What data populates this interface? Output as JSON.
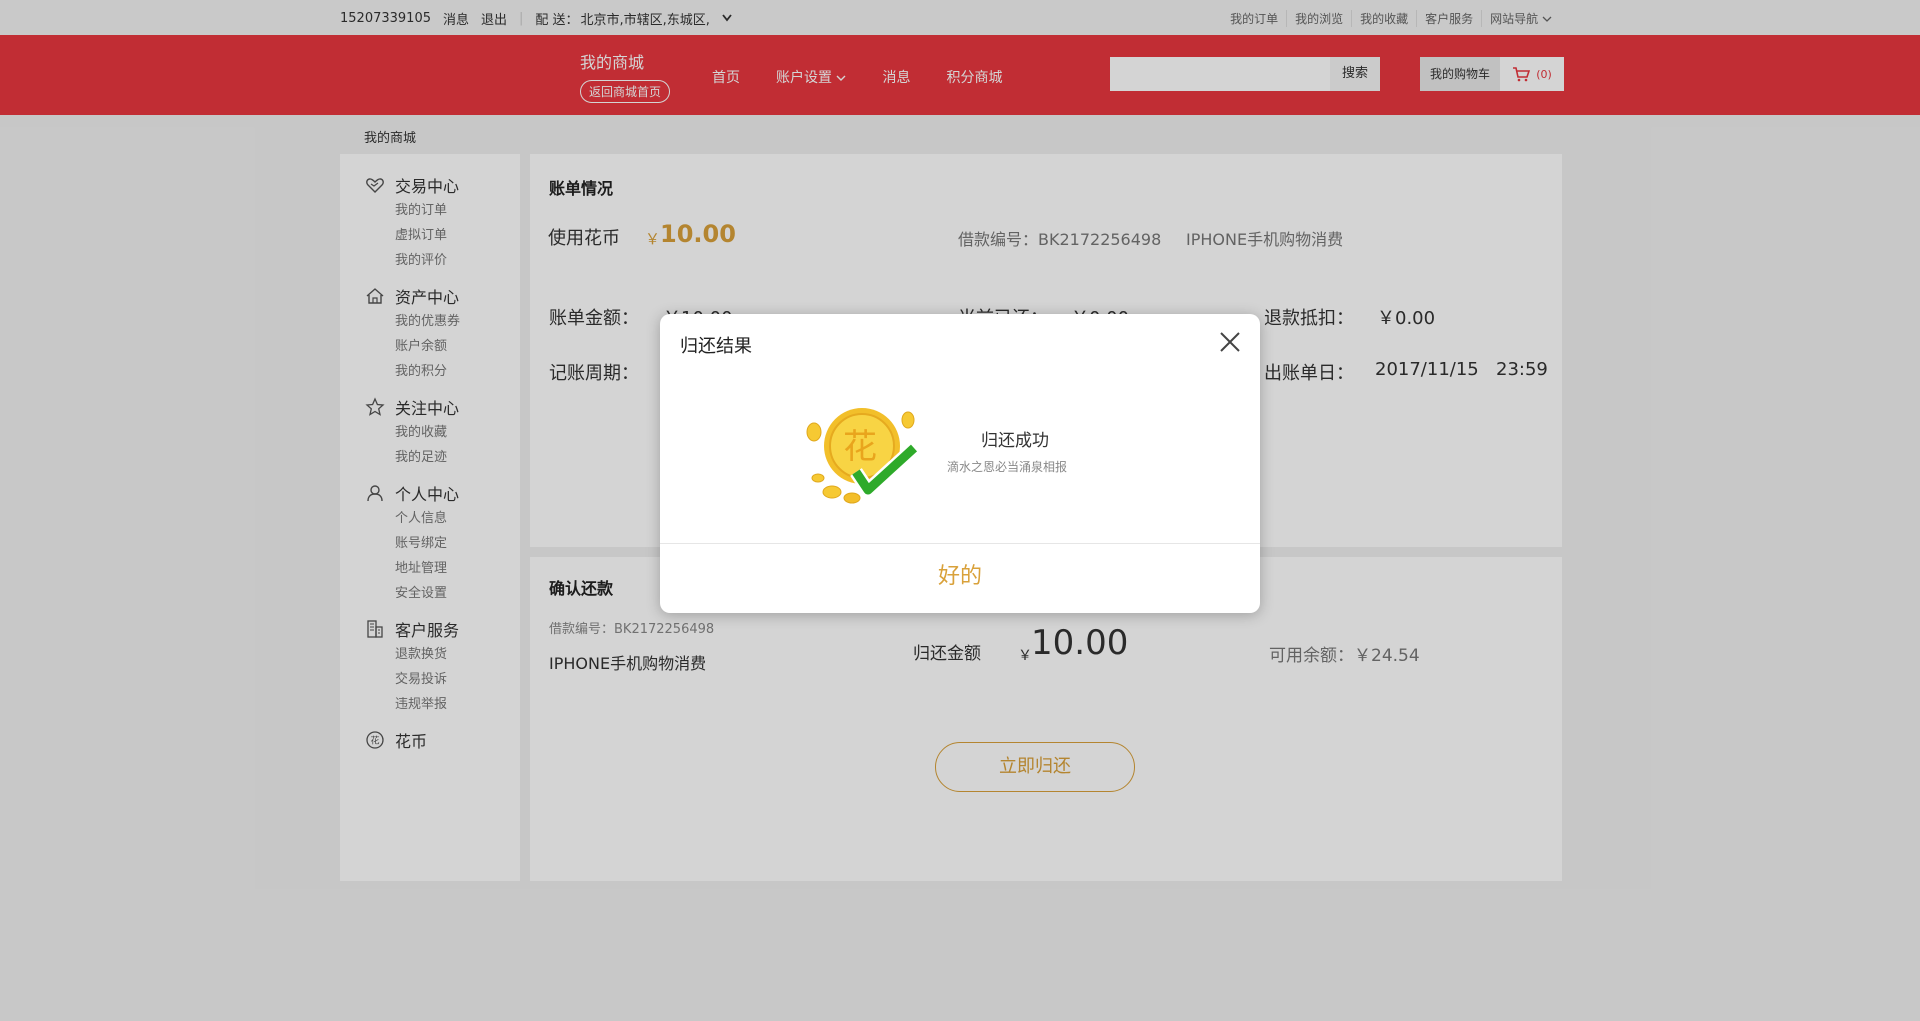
{
  "topbar": {
    "phone": "15207339105",
    "message": "消息",
    "logout": "退出",
    "delivery_label": "配  送：",
    "delivery_location": "北京市,市辖区,东城区,",
    "links": [
      "我的订单",
      "我的浏览",
      "我的收藏",
      "客户服务",
      "网站导航"
    ]
  },
  "header": {
    "brand": "我的商城",
    "back_home": "返回商城首页",
    "nav": [
      "首页",
      "账户设置",
      "消息",
      "积分商城"
    ],
    "search_button": "搜索",
    "search_placeholder": "",
    "cart_label": "我的购物车",
    "cart_count": "(0)"
  },
  "breadcrumb": "我的商城",
  "sidebar": {
    "groups": [
      {
        "title": "交易中心",
        "icon": "handshake-icon",
        "items": [
          "我的订单",
          "虚拟订单",
          "我的评价"
        ]
      },
      {
        "title": "资产中心",
        "icon": "home-icon",
        "items": [
          "我的优惠券",
          "账户余额",
          "我的积分"
        ]
      },
      {
        "title": "关注中心",
        "icon": "star-icon",
        "items": [
          "我的收藏",
          "我的足迹"
        ]
      },
      {
        "title": "个人中心",
        "icon": "user-icon",
        "items": [
          "个人信息",
          "账号绑定",
          "地址管理",
          "安全设置"
        ]
      },
      {
        "title": "客户服务",
        "icon": "building-icon",
        "items": [
          "退款换货",
          "交易投诉",
          "违规举报"
        ]
      },
      {
        "title": "花币",
        "icon": "coin-icon",
        "items": []
      }
    ]
  },
  "bill": {
    "title": "账单情况",
    "use_label": "使用花币",
    "currency": "￥",
    "use_amount": "10.00",
    "loan_no": "借款编号：BK2172256498",
    "desc": "IPHONE手机购物消费",
    "amount_label": "账单金额：",
    "amount_value": "￥10.00",
    "repaid_label": "当前已还：",
    "repaid_value": "￥0.00",
    "refund_label": "退款抵扣：",
    "refund_value": "￥0.00",
    "cycle_label": "记账周期：",
    "bill_date_label": "出账单日：",
    "bill_date": "2017/11/15",
    "bill_time": "23:59"
  },
  "confirm": {
    "title": "确认还款",
    "loan_no": "借款编号：BK2172256498",
    "desc": "IPHONE手机购物消费",
    "return_label": "归还金额",
    "currency": "￥",
    "return_amount": "10.00",
    "available": "可用余额：￥24.54",
    "repay_button": "立即归还"
  },
  "modal": {
    "title": "归还结果",
    "success": "归还成功",
    "subtitle": "滴水之恩必当涌泉相报",
    "coin_char": "花",
    "ok_button": "好的"
  },
  "colors": {
    "brand_red": "#e9373f",
    "gold": "#d9a13a",
    "check_green": "#2eaa2a"
  }
}
